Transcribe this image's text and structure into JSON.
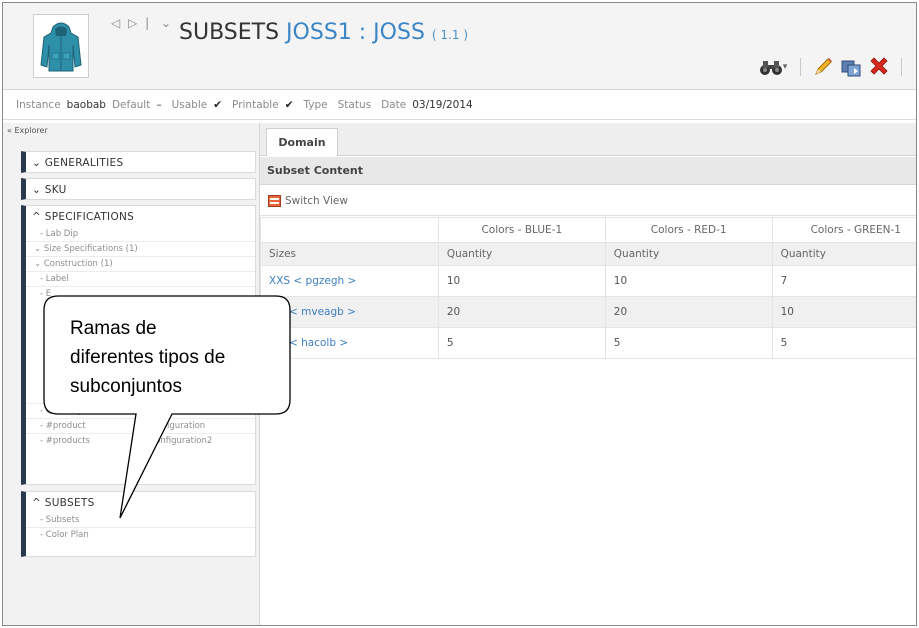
{
  "header": {
    "nav_arrows": "◁ ▷ |",
    "nav_caret": "⌄",
    "title_prefix": "SUBSETS",
    "title_code": "JOSS1 : JOSS",
    "version": "( 1.1 )"
  },
  "status": {
    "instance_label": "Instance",
    "instance_value": "baobab",
    "default_label": "Default",
    "default_value": "–",
    "usable_label": "Usable",
    "usable_check": "✔",
    "printable_label": "Printable",
    "printable_check": "✔",
    "type_label": "Type",
    "status_label": "Status",
    "date_label": "Date",
    "date_value": "03/19/2014"
  },
  "explorer": {
    "title": "« Explorer",
    "generalities": "⌄ GENERALITIES",
    "sku": "⌄ SKU",
    "specifications": "^ SPECIFICATIONS",
    "spec_items": [
      "- Lab Dip",
      "⌄ Size Specifications (1)",
      "⌄ Construction (1)",
      "- Label",
      "- E"
    ],
    "spec_items_lower": [
      "- Quantity",
      "- #product                  myConfiguration",
      "- #products                 myConfiguration2"
    ],
    "subsets": "^ SUBSETS",
    "subset_items": [
      "- Subsets",
      "- Color Plan"
    ]
  },
  "main": {
    "tab": "Domain",
    "section_title": "Subset Content",
    "switch_view": "Switch View",
    "color_headers": [
      "",
      "Colors - BLUE-1",
      "Colors - RED-1",
      "Colors - GREEN-1"
    ],
    "sub_headers": [
      "Sizes",
      "Quantity",
      "Quantity",
      "Quantity"
    ],
    "rows": [
      [
        "XXS < pgzegh >",
        "10",
        "10",
        "7"
      ],
      [
        "< mveagb >",
        "20",
        "20",
        "10"
      ],
      [
        "< hacolb >",
        "5",
        "5",
        "5"
      ]
    ]
  },
  "callout": {
    "lines": [
      "Ramas de",
      "diferentes tipos de",
      "subconjuntos"
    ]
  },
  "colors": {
    "accent_blue": "#3d86c6",
    "section_bar": "#2d3a4d",
    "delete_red": "#d9281e"
  },
  "icons": [
    "binoculars-icon",
    "pencil-icon",
    "copy-icon",
    "delete-icon",
    "switch-view-icon",
    "jacket-thumbnail"
  ]
}
